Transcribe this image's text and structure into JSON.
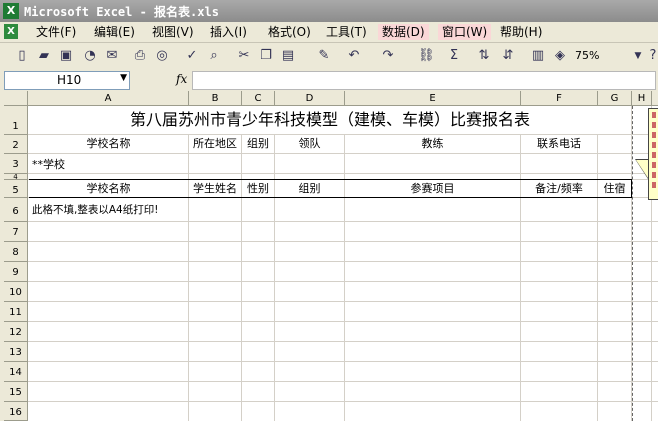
{
  "window": {
    "title": "Microsoft Excel - 报名表.xls"
  },
  "menu": [
    "文件(F)",
    "编辑(E)",
    "视图(V)",
    "插入(I)",
    "格式(O)",
    "工具(T)",
    "数据(D)",
    "窗口(W)",
    "帮助(H)"
  ],
  "toolbar": {
    "zoom": "75%"
  },
  "formula": {
    "cell_ref": "H10",
    "fx": "fx"
  },
  "columns": [
    "A",
    "B",
    "C",
    "D",
    "E",
    "F",
    "G",
    "H"
  ],
  "rows": [
    "1",
    "2",
    "3",
    "4",
    "5",
    "6",
    "7",
    "8",
    "9",
    "10",
    "11",
    "12",
    "13",
    "14",
    "15",
    "16"
  ],
  "sheet": {
    "title": "第八届苏州市青少年科技模型（建模、车模）比赛报名表",
    "row2": {
      "school_name": "学校名称",
      "region": "所在地区",
      "group": "组别",
      "leader": "领队",
      "coach": "教练",
      "phone": "联系电话"
    },
    "row3": {
      "school": "**学校"
    },
    "row5": {
      "school_name": "学校名称",
      "student": "学生姓名",
      "gender": "性别",
      "group": "组别",
      "event": "参赛项目",
      "note": "备注/频率",
      "lodging": "住宿"
    },
    "row6": {
      "note": "此格不填,整表以A4纸打印!"
    }
  }
}
